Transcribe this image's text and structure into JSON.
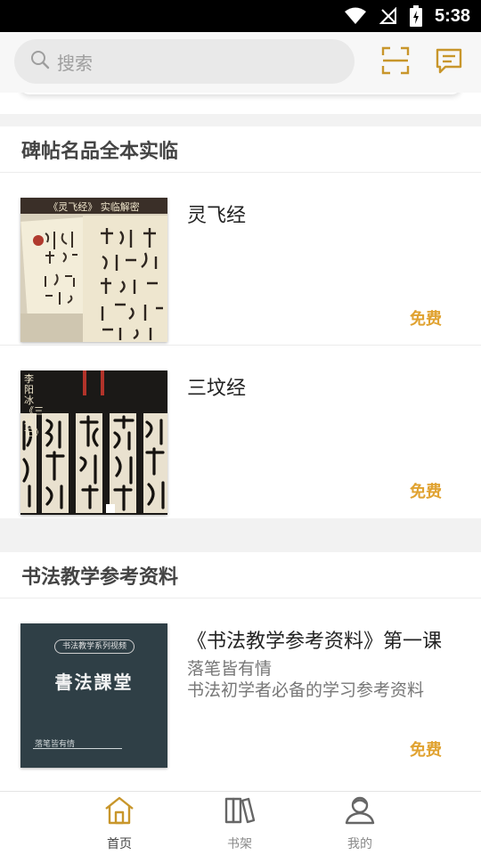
{
  "status_bar": {
    "time": "5:38"
  },
  "search": {
    "placeholder": "搜索"
  },
  "sections": [
    {
      "title": "碑帖名品全本实临",
      "items": [
        {
          "title": "灵飞经",
          "price": "免费",
          "cover": {
            "header_text": "《灵飞经》 实临解密"
          }
        },
        {
          "title": "三坟经",
          "price": "免费",
          "cover": {
            "side_text": "李阳冰《三坟记》"
          }
        }
      ]
    },
    {
      "title": "书法教学参考资料",
      "items": [
        {
          "title": "《书法教学参考资料》第一课",
          "subtitle_lines": [
            "落笔皆有情",
            "书法初学者必备的学习参考资料"
          ],
          "price": "免费",
          "cover": {
            "series_label": "书法教学系列视频",
            "main_title": "書法課堂",
            "tagline": "落笔皆有情"
          }
        }
      ]
    }
  ],
  "bottom_nav": [
    {
      "label": "首页",
      "icon": "home-icon",
      "active": true
    },
    {
      "label": "书架",
      "icon": "bookshelf-icon",
      "active": false
    },
    {
      "label": "我的",
      "icon": "profile-icon",
      "active": false
    }
  ],
  "colors": {
    "accent": "#c8962b",
    "price": "#e0a230",
    "nav_active": "#c8962b",
    "nav_inactive": "#8a8a8a",
    "book3_cover": "#2f3f46"
  }
}
